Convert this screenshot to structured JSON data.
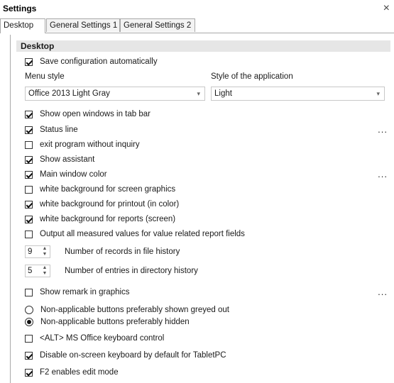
{
  "window": {
    "title": "Settings",
    "close_glyph": "×"
  },
  "tabs": [
    {
      "label": "Desktop",
      "active": true
    },
    {
      "label": "General Settings 1",
      "active": false
    },
    {
      "label": "General Settings 2",
      "active": false
    }
  ],
  "section": {
    "title": "Desktop"
  },
  "save_config": {
    "label": "Save configuration automatically",
    "checked": true
  },
  "menu_style": {
    "label": "Menu style",
    "value": "Office 2013 Light Gray"
  },
  "app_style": {
    "label": "Style of the application",
    "value": "Light"
  },
  "options": [
    {
      "label": "Show open windows in tab bar",
      "checked": true
    },
    {
      "label": "Status line",
      "checked": true
    },
    {
      "label": "exit program without inquiry",
      "checked": false
    },
    {
      "label": "Show assistant",
      "checked": true
    },
    {
      "label": "Main window color",
      "checked": true
    },
    {
      "label": "white background for screen graphics",
      "checked": false
    },
    {
      "label": "white background for printout (in color)",
      "checked": true
    },
    {
      "label": "white background for reports (screen)",
      "checked": true
    },
    {
      "label": "Output all measured values for value related report fields",
      "checked": false
    }
  ],
  "file_history": {
    "value": "9",
    "label": "Number of records in file history"
  },
  "dir_history": {
    "value": "5",
    "label": "Number of entries in directory history"
  },
  "show_remark": {
    "label": "Show remark in graphics",
    "checked": false
  },
  "radios": [
    {
      "label": "Non-applicable buttons preferably shown greyed out",
      "selected": false
    },
    {
      "label": "Non-applicable buttons preferably hidden",
      "selected": true
    }
  ],
  "bottom_options": [
    {
      "label": "<ALT> MS Office keyboard control",
      "checked": false
    },
    {
      "label": "Disable on-screen keyboard by default for TabletPC",
      "checked": true
    },
    {
      "label": "F2 enables edit mode",
      "checked": true
    }
  ],
  "more_button": {
    "label": "..."
  },
  "glyphs": {
    "combo_arrow": "▾",
    "spin_up": "▲",
    "spin_down": "▼"
  }
}
